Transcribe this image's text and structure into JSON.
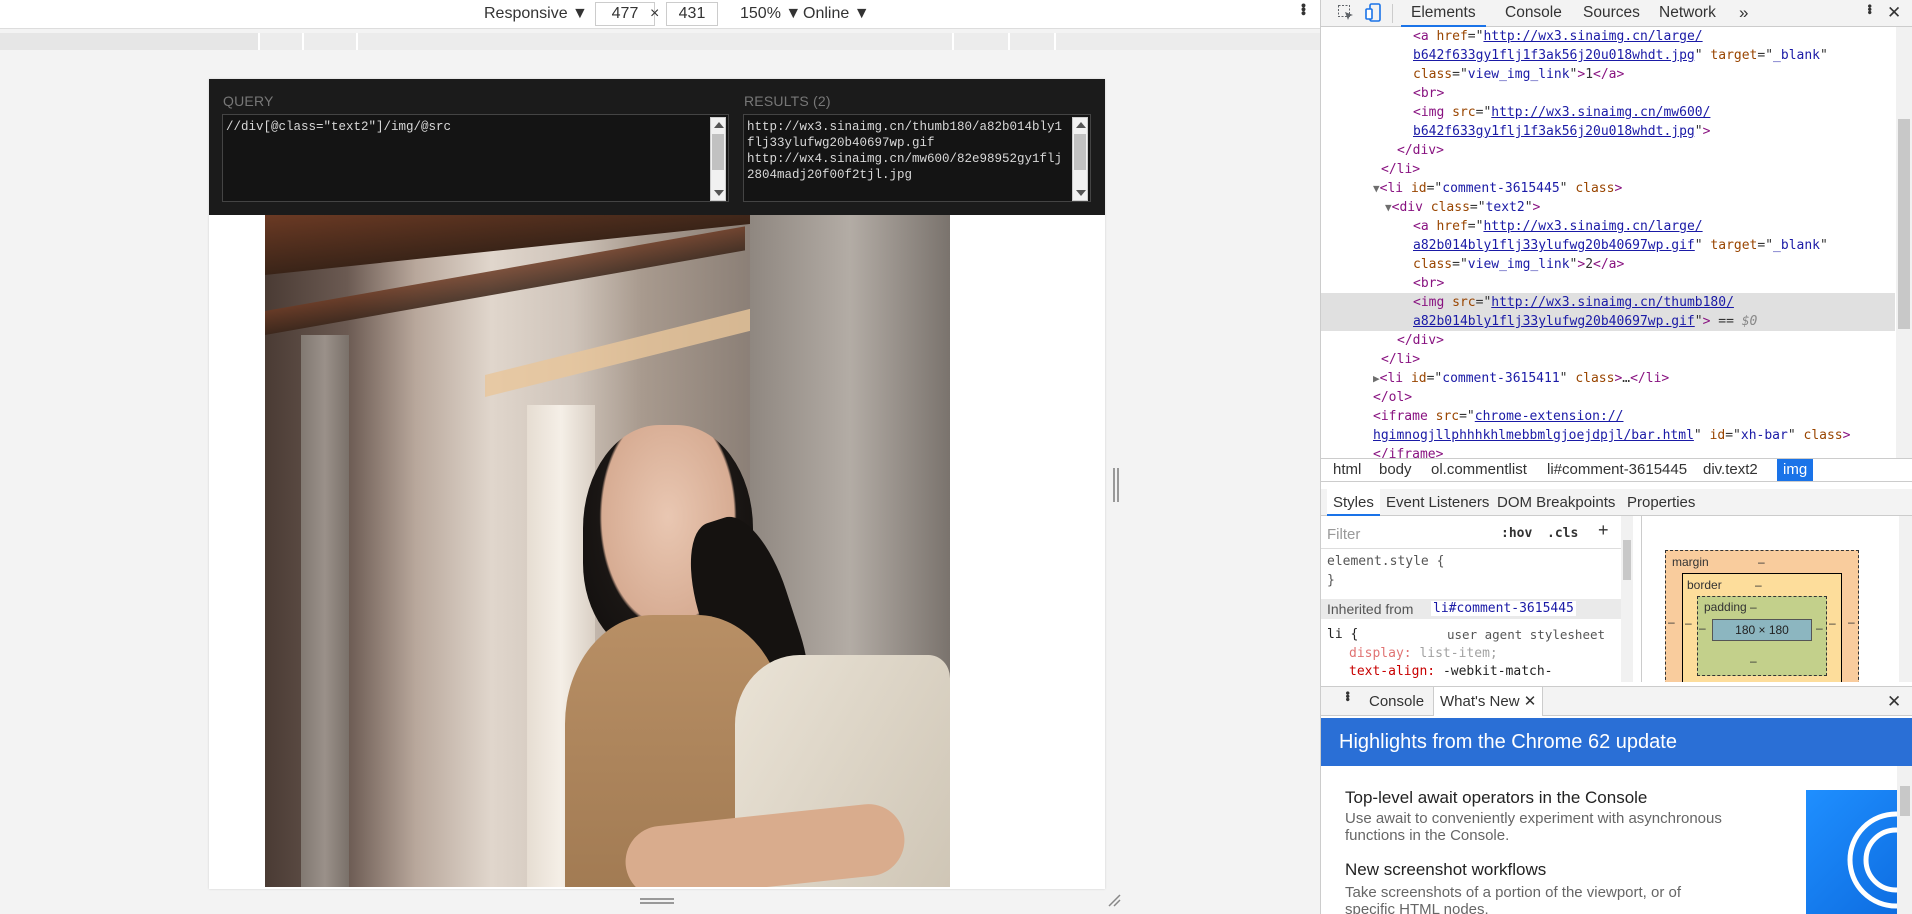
{
  "device_toolbar": {
    "device": "Responsive ▼",
    "width": "477",
    "times": "×",
    "height": "431",
    "zoom": "150% ▼",
    "network": "Online ▼"
  },
  "xpath_helper": {
    "query_label": "QUERY",
    "query": "//div[@class=\"text2\"]/img/@src",
    "results_label": "RESULTS (2)",
    "results": "http://wx3.sinaimg.cn/thumb180/a82b014bly1flj33ylufwg20b40697wp.gif\nhttp://wx4.sinaimg.cn/mw600/82e98952gy1flj2804madj20f00f2tjl.jpg"
  },
  "devtools": {
    "tabs": [
      "Elements",
      "Console",
      "Sources",
      "Network"
    ],
    "more": "»",
    "elements_lines": [
      {
        "indent": 4,
        "html": "<span class=\"tag\">&lt;a</span> <span class=\"an\">href</span>=\"<span class=\"lk\">http://wx3.sinaimg.cn/large/</span>"
      },
      {
        "indent": 4,
        "html": "<span class=\"lk\">b642f633gy1flj1f3ak56j20u018whdt.jpg</span>\" <span class=\"an\">target</span>=\"<span class=\"av\">_blank</span>\""
      },
      {
        "indent": 4,
        "html": "<span class=\"an\">class</span>=\"<span class=\"av\">view_img_link</span>\"<span class=\"tag\">&gt;</span>1<span class=\"tag\">&lt;/a&gt;</span>"
      },
      {
        "indent": 4,
        "html": "<span class=\"tag\">&lt;br&gt;</span>"
      },
      {
        "indent": 4,
        "html": "<span class=\"tag\">&lt;img</span> <span class=\"an\">src</span>=\"<span class=\"lk\">http://wx3.sinaimg.cn/mw600/</span>"
      },
      {
        "indent": 4,
        "html": "<span class=\"lk\">b642f633gy1flj1f3ak56j20u018whdt.jpg</span>\"<span class=\"tag\">&gt;</span>"
      },
      {
        "indent": 3,
        "html": "<span class=\"tag\">&lt;/div&gt;</span>"
      },
      {
        "indent": 2,
        "html": "<span class=\"tag\">&lt;/li&gt;</span>"
      },
      {
        "indent": 1,
        "html": "<span class=\"tri\">▼</span><span class=\"tag\">&lt;li</span> <span class=\"an\">id</span>=\"<span class=\"av\">comment-3615445</span>\" <span class=\"an\">class</span><span class=\"tag\">&gt;</span>"
      },
      {
        "indent": 2,
        "html": "<span class=\"tri\">▼</span><span class=\"tag\">&lt;div</span> <span class=\"an\">class</span>=\"<span class=\"av\">text2</span>\"<span class=\"tag\">&gt;</span>"
      },
      {
        "indent": 4,
        "html": "<span class=\"tag\">&lt;a</span> <span class=\"an\">href</span>=\"<span class=\"lk\">http://wx3.sinaimg.cn/large/</span>"
      },
      {
        "indent": 4,
        "html": "<span class=\"lk\">a82b014bly1flj33ylufwg20b40697wp.gif</span>\" <span class=\"an\">target</span>=\"<span class=\"av\">_blank</span>\""
      },
      {
        "indent": 4,
        "html": "<span class=\"an\">class</span>=\"<span class=\"av\">view_img_link</span>\"<span class=\"tag\">&gt;</span>2<span class=\"tag\">&lt;/a&gt;</span>"
      },
      {
        "indent": 4,
        "html": "<span class=\"tag\">&lt;br&gt;</span>"
      },
      {
        "indent": 4,
        "sel": true,
        "html": "<span class=\"tag\">&lt;img</span> <span class=\"an\">src</span>=\"<span class=\"lk\">http://wx3.sinaimg.cn/thumb180/</span>"
      },
      {
        "indent": 4,
        "sel": true,
        "html": "<span class=\"lk\">a82b014bly1flj33ylufwg20b40697wp.gif</span>\"<span class=\"tag\">&gt;</span> == <i style=\"color:#888\">$0</i>"
      },
      {
        "indent": 3,
        "html": "<span class=\"tag\">&lt;/div&gt;</span>"
      },
      {
        "indent": 2,
        "html": "<span class=\"tag\">&lt;/li&gt;</span>"
      },
      {
        "indent": 1,
        "html": "<span class=\"tri\">▶</span><span class=\"tag\">&lt;li</span> <span class=\"an\">id</span>=\"<span class=\"av\">comment-3615411</span>\" <span class=\"an\">class</span><span class=\"tag\">&gt;</span>…<span class=\"tag\">&lt;/li&gt;</span>"
      },
      {
        "indent": 1,
        "html": "<span class=\"tag\">&lt;/ol&gt;</span>"
      },
      {
        "indent": 1,
        "html": "<span class=\"tag\">&lt;iframe</span> <span class=\"an\">src</span>=\"<span class=\"lk\">chrome-extension://</span>"
      },
      {
        "indent": 1,
        "html": "<span class=\"lk\">hgimnogjllphhhkhlmebbmlgjoejdpjl/bar.html</span>\" <span class=\"an\">id</span>=\"<span class=\"av\">xh-bar</span>\" <span class=\"an\">class</span><span class=\"tag\">&gt;</span>"
      },
      {
        "indent": 1,
        "html": "<span class=\"tag\">&lt;/iframe&gt;</span>"
      }
    ],
    "breadcrumbs": [
      "html",
      "body",
      "ol.commentlist",
      "li#comment-3615445",
      "div.text2",
      "img"
    ],
    "styles_tabs": [
      "Styles",
      "Event Listeners",
      "DOM Breakpoints",
      "Properties"
    ],
    "filter_placeholder": "Filter",
    "hov": ":hov",
    "cls": ".cls",
    "plus": "+",
    "element_style": "element.style {",
    "close_brace": "}",
    "inherited_from": "Inherited from",
    "inherited_link": "li#comment-3615445",
    "li_rule": "li {",
    "ua_stylesheet": "user agent stylesheet",
    "prop1_name": "display",
    "prop1_value": "list-item;",
    "prop2_name": "text-align",
    "prop2_value": "-webkit-match-",
    "box": {
      "margin": "margin",
      "border": "border",
      "padding": "padding",
      "dash": "–",
      "size": "180 × 180"
    },
    "drawer_tabs": [
      "Console",
      "What's New"
    ],
    "banner": "Highlights from the Chrome 62 update",
    "whats_new": [
      {
        "title": "Top-level await operators in the Console",
        "body": "Use await to conveniently experiment with asynchronous functions in the Console."
      },
      {
        "title": "New screenshot workflows",
        "body": "Take screenshots of a portion of the viewport, or of specific HTML nodes."
      }
    ]
  }
}
